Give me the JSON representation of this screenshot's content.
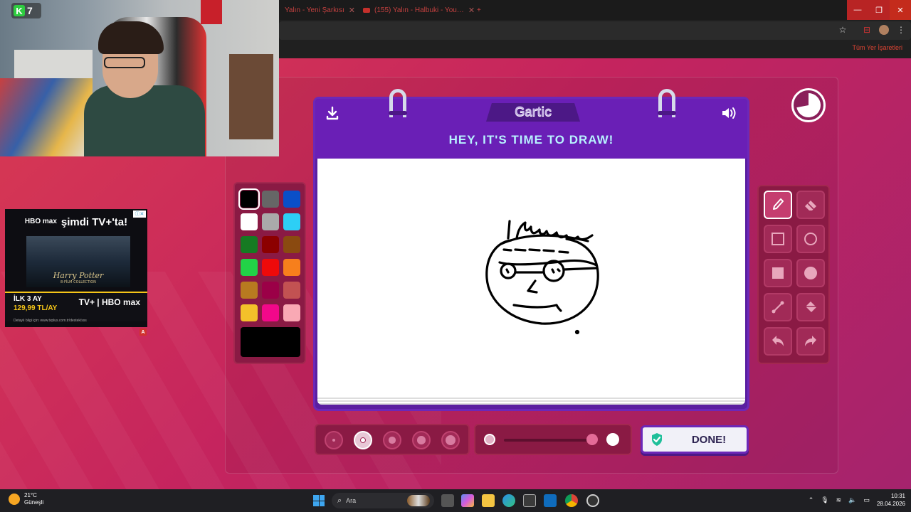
{
  "browser": {
    "tabs": [
      {
        "label": "Yalın - Yeni Şarkısı",
        "icon": "tab-icon"
      },
      {
        "label": "(155) Yalın - Halbuki - You…",
        "icon": "youtube-icon"
      }
    ],
    "new_tab_label": "+",
    "bookmarks_right": "Tüm Yer İşaretleri",
    "window_controls": {
      "minimize": "—",
      "maximize": "❐",
      "close": "✕"
    }
  },
  "webcam": {
    "channel_letter": "K",
    "channel_number": "7"
  },
  "ad": {
    "brand_top": "HBO max",
    "headline": "şimdi TV+'ta!",
    "movie_title": "Harry Potter",
    "movie_sub": "8-FİLM COLLECTION",
    "offer_line1": "İLK 3 AY",
    "offer_line2": "129,99 TL/AY",
    "logos": "TV+ | HBO max",
    "footer": "Detaylı bilgi için: www.tvplus.com.tr/destek/sss",
    "badge": "A"
  },
  "game": {
    "logo": "Gartic",
    "title": "HEY, IT'S TIME TO DRAW!",
    "timer_fraction_remaining": 0.72,
    "done_label": "DONE!",
    "palette": [
      "#000000",
      "#666666",
      "#0a4fc8",
      "#ffffff",
      "#aaaaaa",
      "#2dcff5",
      "#167a22",
      "#8c0000",
      "#8a4a10",
      "#22d247",
      "#ee0a0a",
      "#f77f1c",
      "#b87a20",
      "#9b0047",
      "#c25252",
      "#f3c12a",
      "#f2088a",
      "#f9a9b4"
    ],
    "selected_color": "#000000",
    "tools": [
      {
        "name": "pen-tool",
        "icon": "pencil-icon",
        "active": true
      },
      {
        "name": "eraser-tool",
        "icon": "eraser-icon",
        "active": false
      },
      {
        "name": "rectangle-outline-tool",
        "icon": "square-outline-icon",
        "active": false
      },
      {
        "name": "ellipse-outline-tool",
        "icon": "circle-outline-icon",
        "active": false
      },
      {
        "name": "rectangle-fill-tool",
        "icon": "square-fill-icon",
        "active": false
      },
      {
        "name": "ellipse-fill-tool",
        "icon": "circle-fill-icon",
        "active": false
      },
      {
        "name": "line-tool",
        "icon": "line-icon",
        "active": false
      },
      {
        "name": "fill-tool",
        "icon": "bucket-icon",
        "active": false
      },
      {
        "name": "undo-tool",
        "icon": "undo-icon",
        "active": false
      },
      {
        "name": "redo-tool",
        "icon": "redo-icon",
        "active": false
      }
    ],
    "brush_sizes": [
      1,
      2,
      3,
      4,
      5
    ],
    "selected_brush_size": 2,
    "opacity": 0.95
  },
  "taskbar": {
    "weather_temp": "21°C",
    "weather_desc": "Güneşli",
    "search_placeholder": "Ara",
    "time": "10:31",
    "date": "28.04.2026"
  }
}
